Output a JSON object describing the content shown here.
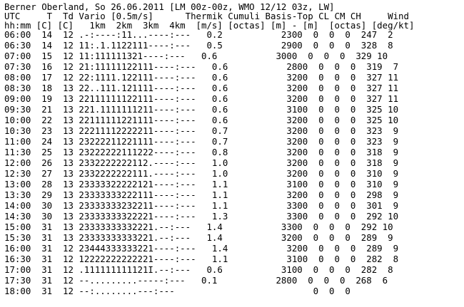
{
  "document": {
    "title_line": "Berner Oberland, So 26.06.2011 [LM 00z-00z, WMO 12/12 03z, LW]",
    "header_line1": "UTC     T  Td Vario [0.5m/s]      Thermik Cumuli Basis-Top CL CM CH     Wind",
    "header_line2": "hh:mm [C] [C]   1km  2km  3km  4km  [m/s] [octas] [m] - [m]  [octas] [deg/kt]",
    "rows": [
      "06:00  14  12 .-:----:11...----:---   0.2           2300  0  0  0  247  2",
      "06:30  14  12 11:.1.1122111----:---   0.5           2900  0  0  0  328  8",
      "07:00  15  12 11:111111321----:---   0.6           3000  0  0  0  329 10",
      "07:30  16  12 21:11111122111----:---   0.6           2800  0  0  0  319  7",
      "08:00  17  12 22:1111.122111----:---   0.6           3200  0  0  0  327 11",
      "08:30  18  13 22..111.121111----:---   0.6           3200  0  0  0  327 11",
      "09:00  19  13 22111111122111----:---   0.6           3200  0  0  0  327 11",
      "09:30  21  13 221.1111111211----:---   0.6           3100  0  0  0  325 10",
      "10:00  22  13 22111111221111----:---   0.6           3200  0  0  0  325 10",
      "10:30  23  13 22211112222211----:---   0.7           3200  0  0  0  323  9",
      "11:00  24  13 23222211221111----:---   0.7           3200  0  0  0  323  9",
      "11:30  25  13 23222222111222----:---   0.8           3200  0  0  0  318  9",
      "12:00  26  13 2332222222112.----:---   1.0           3200  0  0  0  318  9",
      "12:30  27  13 2332222222111.----:---   1.0           3200  0  0  0  310  9",
      "13:00  28  13 23333322222121----:---   1.1           3100  0  0  0  310  9",
      "13:30  29  13 23333333222111----:---   1.1           3200  0  0  0  298  9",
      "14:00  30  13 23333333232211----:---   1.1           3300  0  0  0  301  9",
      "14:30  30  13 23333333322221----:---   1.3           3300  0  0  0  292 10",
      "15:00  31  13 23333333332221.--:---   1.4           3300  0  0  0  292 10",
      "15:30  31  13 23333333333221.--:---   1.4           3200  0  0  0  289  9",
      "16:00  31  12 23444333333221----:---   1.4           3200  0  0  0  289  9",
      "16:30  31  12 12222222222221----:---   1.1           3100  0  0  0  282  8",
      "17:00  31  12 .111111111121I.--:---   0.6           3100  0  0  0  282  8",
      "17:30  31  12 --.........-----:---   0.1           2800  0  0  0  268  6",
      "18:00  31  12 --:........---:---                          0  0  0"
    ]
  }
}
